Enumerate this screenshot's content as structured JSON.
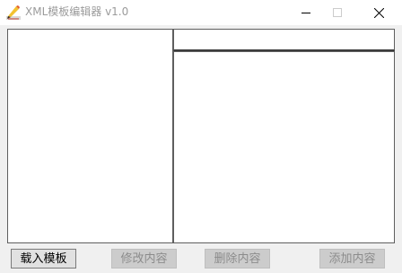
{
  "window": {
    "title": "XML模板编辑器 v1.0"
  },
  "icons": {
    "app": "pencil-icon",
    "minimize": "minimize-icon",
    "maximize": "maximize-icon",
    "close": "close-icon"
  },
  "buttons": {
    "load_template": "载入模板",
    "modify_content": "修改内容",
    "delete_content": "删除内容",
    "add_content": "添加内容"
  },
  "colors": {
    "background": "#f0f0f0",
    "panel": "#ffffff",
    "disabled_text": "#8c8c8c"
  }
}
